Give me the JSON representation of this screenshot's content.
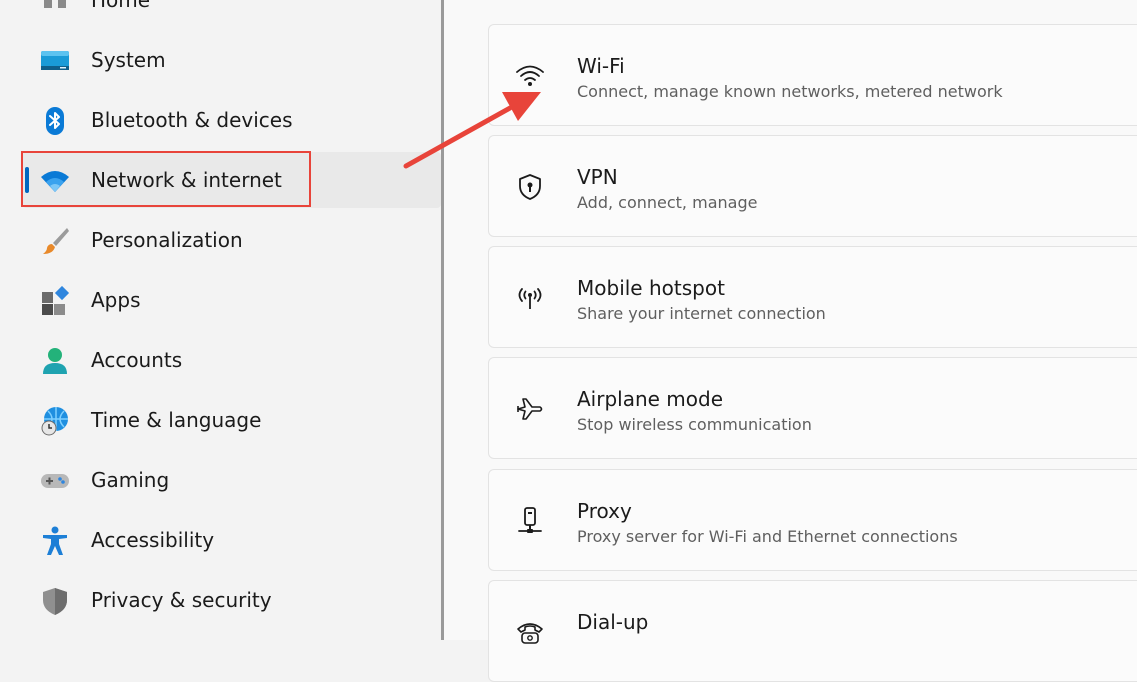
{
  "sidebar": {
    "items": [
      {
        "label": "Home",
        "icon": "home-icon"
      },
      {
        "label": "System",
        "icon": "system-icon"
      },
      {
        "label": "Bluetooth & devices",
        "icon": "bluetooth-icon"
      },
      {
        "label": "Network & internet",
        "icon": "wifi-icon",
        "selected": true
      },
      {
        "label": "Personalization",
        "icon": "brush-icon"
      },
      {
        "label": "Apps",
        "icon": "apps-icon"
      },
      {
        "label": "Accounts",
        "icon": "account-icon"
      },
      {
        "label": "Time & language",
        "icon": "globe-clock-icon"
      },
      {
        "label": "Gaming",
        "icon": "gamepad-icon"
      },
      {
        "label": "Accessibility",
        "icon": "accessibility-icon"
      },
      {
        "label": "Privacy & security",
        "icon": "shield-icon"
      }
    ]
  },
  "main": {
    "cards": [
      {
        "title": "Wi-Fi",
        "subtitle": "Connect, manage known networks, metered network",
        "icon": "wifi-icon"
      },
      {
        "title": "VPN",
        "subtitle": "Add, connect, manage",
        "icon": "vpn-shield-icon"
      },
      {
        "title": "Mobile hotspot",
        "subtitle": "Share your internet connection",
        "icon": "hotspot-icon"
      },
      {
        "title": "Airplane mode",
        "subtitle": "Stop wireless communication",
        "icon": "airplane-icon"
      },
      {
        "title": "Proxy",
        "subtitle": "Proxy server for Wi-Fi and Ethernet connections",
        "icon": "proxy-icon"
      },
      {
        "title": "Dial-up",
        "subtitle": "",
        "icon": "phone-icon"
      }
    ]
  },
  "colors": {
    "accent": "#0067c0",
    "annotation_red": "#e8443a",
    "selected_bg": "#e9e9e9"
  }
}
